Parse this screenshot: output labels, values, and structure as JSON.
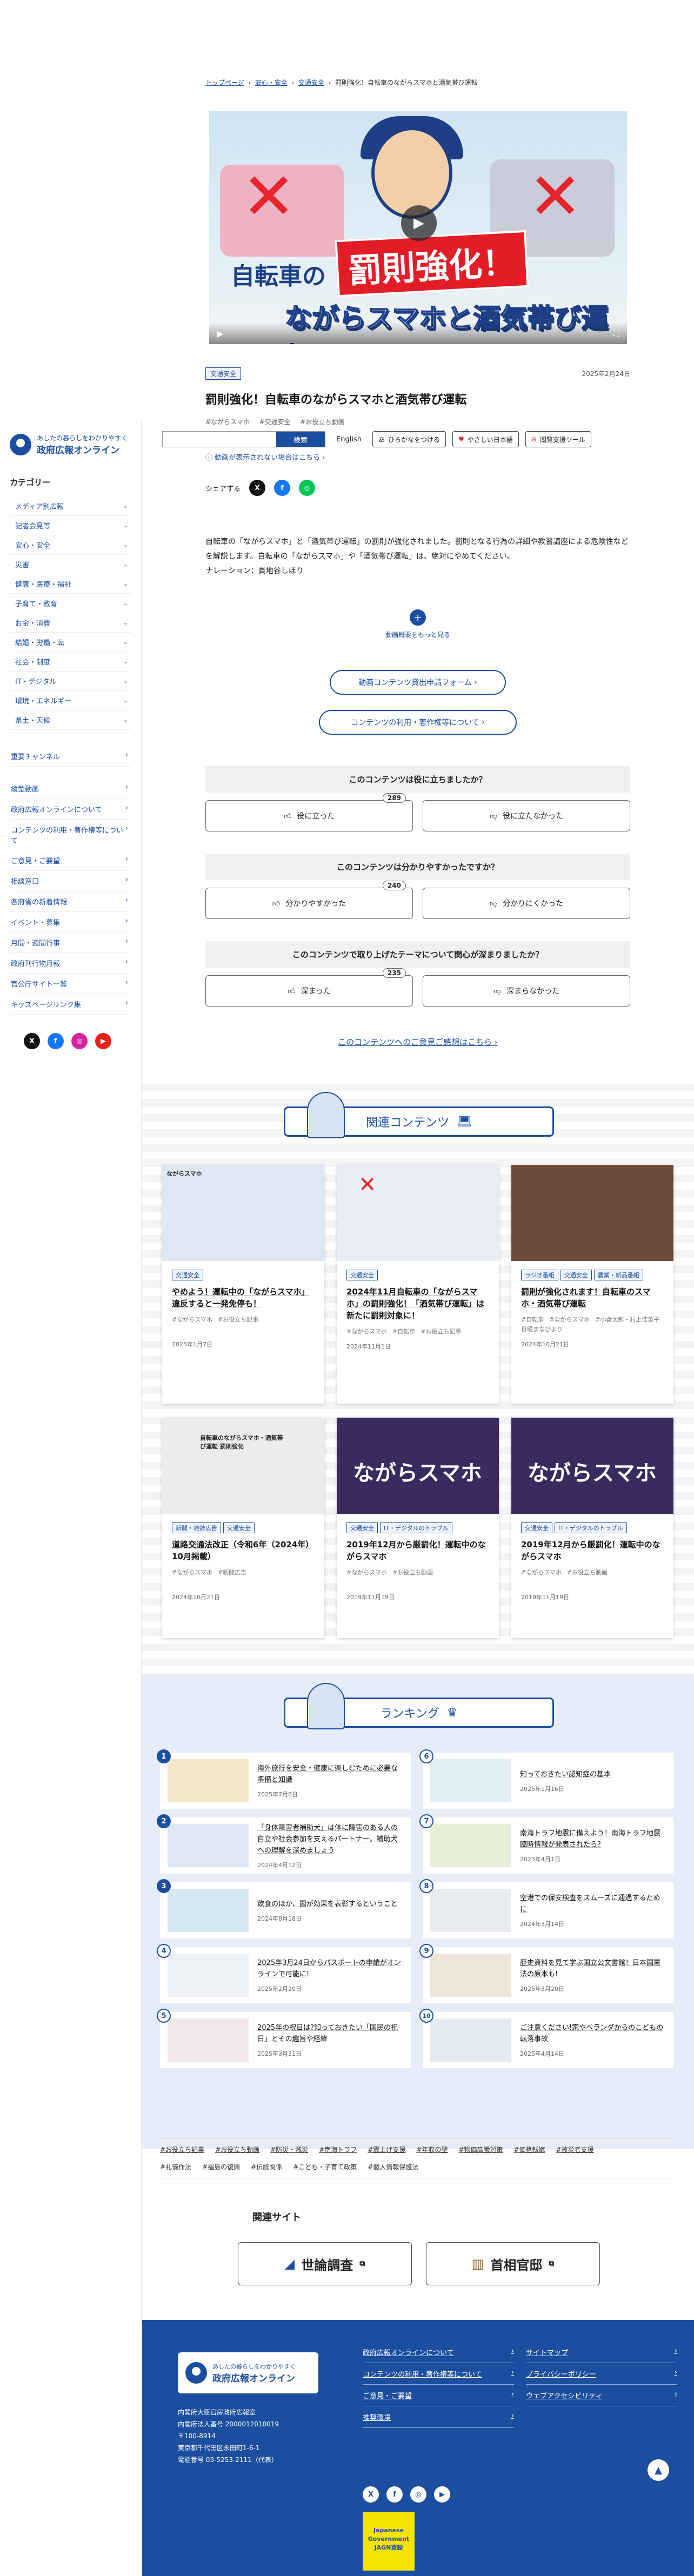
{
  "breadcrumb": [
    "トップページ",
    "安心・安全",
    "交通安全",
    "罰則強化！自転車のながらスマホと酒気帯び運転"
  ],
  "hero": {
    "line1": "自転車の",
    "badge": "罰則強化！",
    "line2": "ながらスマホと酒気帯び運転"
  },
  "article": {
    "tag": "交通安全",
    "date": "2025年2月24日",
    "title": "罰則強化！自転車のながらスマホと酒気帯び運転",
    "hashtags": [
      "#ながらスマホ",
      "#交通安全",
      "#お役立ち動画"
    ],
    "help_link": "動画が表示されない場合はこちら",
    "share_label": "シェアする",
    "description": "自転車の「ながらスマホ」と「酒気帯び運転」の罰則が強化されました。罰則となる行為の詳細や教習講座による危険性などを解説します。自転車の「ながらスマホ」や「酒気帯び運転」は、絶対にやめてください。",
    "narration": "ナレーション：貫地谷しほり",
    "more_label": "動画概要をもっと見る",
    "form_button": "動画コンテンツ貸出申請フォーム",
    "usage_button": "コンテンツの利用・著作権等について"
  },
  "toolbar": {
    "search_placeholder": "",
    "search_button": "検索",
    "lang": "English",
    "furigana": "ひらがなをつける",
    "easy_jp": "やさしい日本語",
    "tools": "閲覧支援ツール"
  },
  "sidebar": {
    "logo_small": "あしたの暮らしをわかりやすく",
    "logo_big": "政府広報オンライン",
    "category_heading": "カテゴリー",
    "categories": [
      "メディア別広報",
      "記者会見等",
      "安心・安全",
      "災害",
      "健康・医療・福祉",
      "子育て・教育",
      "お金・消費",
      "結婚・労働・転",
      "社会・制度",
      "IT・デジタル",
      "環境・エネルギー",
      "県土・天候"
    ],
    "links": [
      "重要チャンネル",
      "縦型動画",
      "政府広報オンラインについて",
      "コンテンツの利用・著作権等について",
      "ご意見・ご要望",
      "相談窓口",
      "各府省の新着情報",
      "イベント・募集",
      "月間・週間行事",
      "政府刊行物月報",
      "官公庁サイト一覧",
      "キッズページリンク集"
    ]
  },
  "survey": [
    {
      "question": "このコンテンツは役に立ちましたか？",
      "yes": "役に立った",
      "no": "役に立たなかった",
      "count": "289"
    },
    {
      "question": "このコンテンツは分かりやすかったですか？",
      "yes": "分かりやすかった",
      "no": "分かりにくかった",
      "count": "240"
    },
    {
      "question": "このコンテンツで取り上げたテーマについて関心が深まりましたか？",
      "yes": "深まった",
      "no": "深まらなかった",
      "count": "235"
    }
  ],
  "feedback_link": "このコンテンツへのご意見ご感想はこちら",
  "related": {
    "heading": "関連コンテンツ",
    "cards": [
      {
        "tags": [
          "交通安全"
        ],
        "title": "やめよう！運転中の「ながらスマホ」違反すると一発免停も！",
        "hashtags": [
          "#ながらスマホ",
          "#お役立ち記事"
        ],
        "date": "2025年1月7日",
        "thumb_color": "#dde8f3",
        "thumb_label": "ながらスマホ"
      },
      {
        "tags": [
          "交通安全"
        ],
        "title": "2024年11月自転車の「ながらスマホ」の罰則強化！「酒気帯び運転」は新たに罰則対象に！",
        "hashtags": [
          "#ながらスマホ",
          "#自転車",
          "#お役立ち記事"
        ],
        "date": "2024年11月1日",
        "thumb_color": "#e9eef6",
        "thumb_label": ""
      },
      {
        "tags": [
          "ラジオ番組",
          "交通安全",
          "農業・新品番組"
        ],
        "title": "罰則が強化されます！自転車のスマホ・酒気帯び運転",
        "hashtags": [
          "#自転車",
          "#ながらスマホ",
          "#小倉太郎・村上佳菜子 日曜まなびより"
        ],
        "date": "2024年10月21日",
        "thumb_color": "#6b4a3a",
        "thumb_label": ""
      },
      {
        "tags": [
          "新聞・雑誌広告",
          "交通安全"
        ],
        "title": "道路交通法改正（令和6年（2024年）10月掲載）",
        "hashtags": [
          "#ながらスマホ",
          "#新聞広告"
        ],
        "date": "2024年10月21日",
        "thumb_color": "#ececec",
        "thumb_label": "自転車のながらスマホ・酒気帯び運転 罰則強化"
      },
      {
        "tags": [
          "交通安全",
          "IT・デジタルのトラブル"
        ],
        "title": "2019年12月から厳罰化！運転中のながらスマホ",
        "hashtags": [
          "#ながらスマホ",
          "#お役立ち動画"
        ],
        "date": "2019年11月19日",
        "thumb_color": "#3b2a5e",
        "thumb_label": "ながらスマホ"
      },
      {
        "tags": [
          "交通安全",
          "IT・デジタルのトラブル"
        ],
        "title": "2019年12月から厳罰化！運転中のながらスマホ",
        "hashtags": [
          "#ながらスマホ",
          "#お役立ち動画"
        ],
        "date": "2019年11月19日",
        "thumb_color": "#3b2a5e",
        "thumb_label": "ながらスマホ"
      }
    ]
  },
  "ranking": {
    "heading": "ランキング",
    "items": [
      {
        "n": "1",
        "title": "海外旅行を安全・健康に楽しむために必要な準備と知識",
        "date": "2025年7月8日"
      },
      {
        "n": "6",
        "title": "知っておきたい認知症の基本",
        "date": "2025年1月16日"
      },
      {
        "n": "2",
        "title": "「身体障害者補助犬」は体に障害のある人の自立や社会参加を支えるパートナー。補助犬への理解を深めましょう",
        "date": "2024年4月12日"
      },
      {
        "n": "7",
        "title": "南海トラフ地震に備えよう！南海トラフ地震臨時情報が発表されたら?",
        "date": "2025年4月1日"
      },
      {
        "n": "3",
        "title": "飲食のほか、国が効果を表彰するということ",
        "date": "2024年8月18日"
      },
      {
        "n": "8",
        "title": "空港での保安検査をスムーズに通過するために",
        "date": "2024年3月14日"
      },
      {
        "n": "4",
        "title": "2025年3月24日からパスポートの申請がオンラインで可能に!",
        "date": "2025年2月20日"
      },
      {
        "n": "9",
        "title": "歴史資料を見て学ぶ国立公文書館！日本国憲法の原本も!",
        "date": "2025年3月20日"
      },
      {
        "n": "5",
        "title": "2025年の祝日は?知っておきたい「国民の祝日」とその趣旨や経緯",
        "date": "2025年3月31日"
      },
      {
        "n": "10",
        "title": "ご注意ください!家やベランダからのこどもの転落事故",
        "date": "2025年4月14日"
      }
    ]
  },
  "hashtag_cloud": [
    "#お役立ち記事",
    "#お役立ち動画",
    "#防災・減災",
    "#南海トラフ",
    "#震上げ支援",
    "#年収の壁",
    "#物価高騰対策",
    "#価格転嫁",
    "#被災者支援",
    "#礼儀作法",
    "#福島の復興",
    "#伝統関係",
    "#こども・子育て政策",
    "#個人情報保護法"
  ],
  "related_sites": {
    "heading": "関連サイト",
    "site1": "世論調査",
    "site2": "首相官邸"
  },
  "footer": {
    "logo_small": "あしたの暮らしをわかりやすく",
    "logo_big": "政府広報オンライン",
    "address": [
      "内閣府大臣官房政府広報室",
      "内閣府法人番号 2000012010019",
      "〒100-8914",
      "東京都千代田区永田町1-6-1",
      "電話番号 03-5253-2111（代表）"
    ],
    "links": [
      "政府広報オンラインについて",
      "サイトマップ",
      "コンテンツの利用・著作権等について",
      "プライバシーポリシー",
      "ご意見・ご要望",
      "ウェブアクセシビリティ",
      "推奨環境",
      ""
    ],
    "badge_text": "Japanese Government JAGN登録"
  },
  "colors": {
    "brand": "#1c4ea0",
    "hero_red": "#e21d27"
  }
}
